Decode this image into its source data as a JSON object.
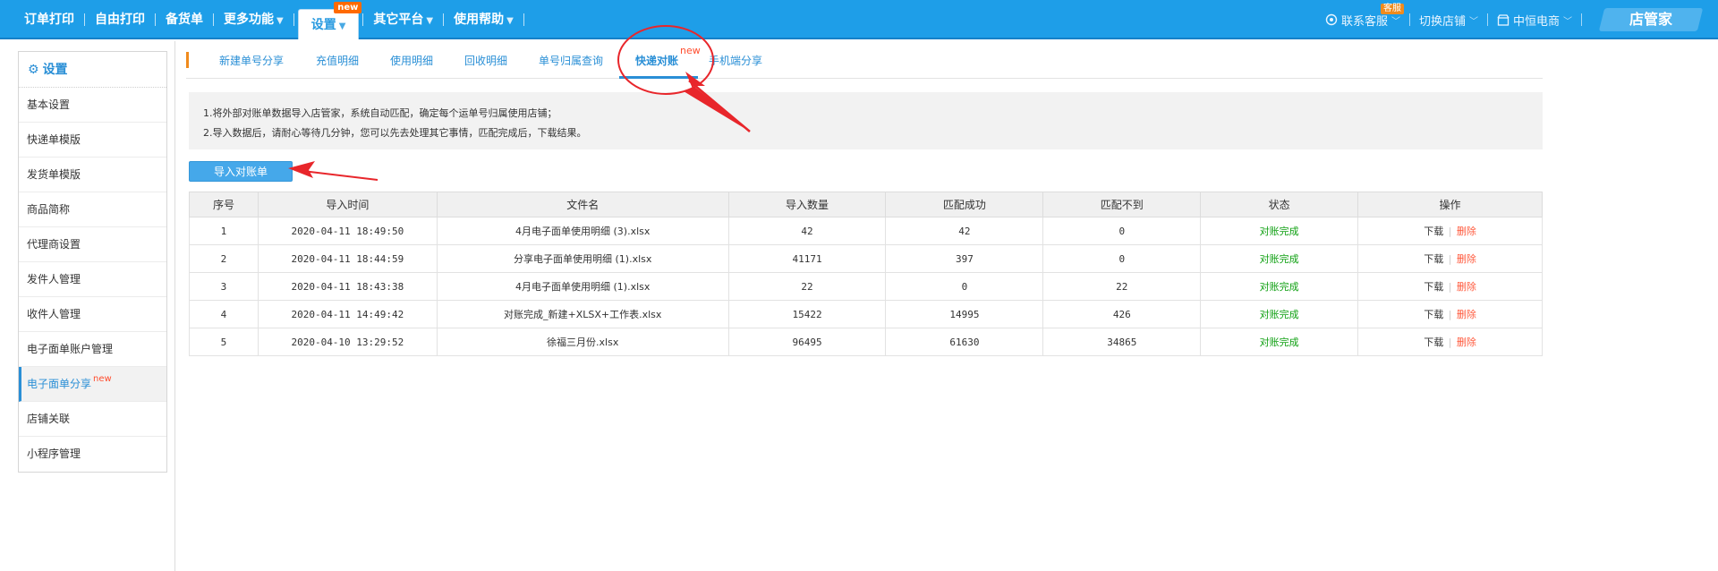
{
  "nav": {
    "items": [
      {
        "label": "订单打印"
      },
      {
        "label": "自由打印"
      },
      {
        "label": "备货单"
      },
      {
        "label": "更多功能",
        "arrow": "▼"
      },
      {
        "label": "设置",
        "arrow": "▼",
        "badge": "new"
      },
      {
        "label": "其它平台",
        "arrow": "▼"
      },
      {
        "label": "使用帮助",
        "arrow": "▼"
      }
    ],
    "right": {
      "support": "联系客服",
      "support_badge": "客服",
      "switch_shop": "切换店铺",
      "shop_name": "中恒电商",
      "brand": "店管家"
    }
  },
  "sidebar": {
    "title": "设置",
    "items": [
      {
        "label": "基本设置"
      },
      {
        "label": "快递单模版"
      },
      {
        "label": "发货单模版"
      },
      {
        "label": "商品简称"
      },
      {
        "label": "代理商设置"
      },
      {
        "label": "发件人管理"
      },
      {
        "label": "收件人管理"
      },
      {
        "label": "电子面单账户管理"
      },
      {
        "label": "电子面单分享",
        "badge": "new"
      },
      {
        "label": "店铺关联"
      },
      {
        "label": "小程序管理"
      }
    ]
  },
  "tabs": [
    {
      "label": "新建单号分享"
    },
    {
      "label": "充值明细"
    },
    {
      "label": "使用明细"
    },
    {
      "label": "回收明细"
    },
    {
      "label": "单号归属查询"
    },
    {
      "label": "快递对账",
      "badge": "new"
    },
    {
      "label": "手机端分享"
    }
  ],
  "notice": {
    "line1": "1.将外部对账单数据导入店管家，系统自动匹配，确定每个运单号归属使用店铺；",
    "line2": "2.导入数据后，请耐心等待几分钟，您可以先去处理其它事情，匹配完成后，下载结果。"
  },
  "import_button": "导入对账单",
  "table": {
    "headers": [
      "序号",
      "导入时间",
      "文件名",
      "导入数量",
      "匹配成功",
      "匹配不到",
      "状态",
      "操作"
    ],
    "rows": [
      {
        "no": "1",
        "time": "2020-04-11 18:49:50",
        "file": "4月电子面单使用明细 (3).xlsx",
        "count": "42",
        "matched": "42",
        "unmatched": "0",
        "status": "对账完成",
        "download": "下载",
        "delete": "删除"
      },
      {
        "no": "2",
        "time": "2020-04-11 18:44:59",
        "file": "分享电子面单使用明细 (1).xlsx",
        "count": "41171",
        "matched": "397",
        "unmatched": "0",
        "status": "对账完成",
        "download": "下载",
        "delete": "删除"
      },
      {
        "no": "3",
        "time": "2020-04-11 18:43:38",
        "file": "4月电子面单使用明细 (1).xlsx",
        "count": "22",
        "matched": "0",
        "unmatched": "22",
        "status": "对账完成",
        "download": "下载",
        "delete": "删除"
      },
      {
        "no": "4",
        "time": "2020-04-11 14:49:42",
        "file": "对账完成_新建+XLSX+工作表.xlsx",
        "count": "15422",
        "matched": "14995",
        "unmatched": "426",
        "status": "对账完成",
        "download": "下载",
        "delete": "删除"
      },
      {
        "no": "5",
        "time": "2020-04-10 13:29:52",
        "file": "徐福三月份.xlsx",
        "count": "96495",
        "matched": "61630",
        "unmatched": "34865",
        "status": "对账完成",
        "download": "下载",
        "delete": "删除"
      }
    ]
  },
  "colors": {
    "nav_bg": "#1e9ee8",
    "accent_blue": "#2a8fd6",
    "status_green": "#0fa012",
    "delete_red": "#ff5a3d",
    "annotation_red": "#e8262b"
  }
}
